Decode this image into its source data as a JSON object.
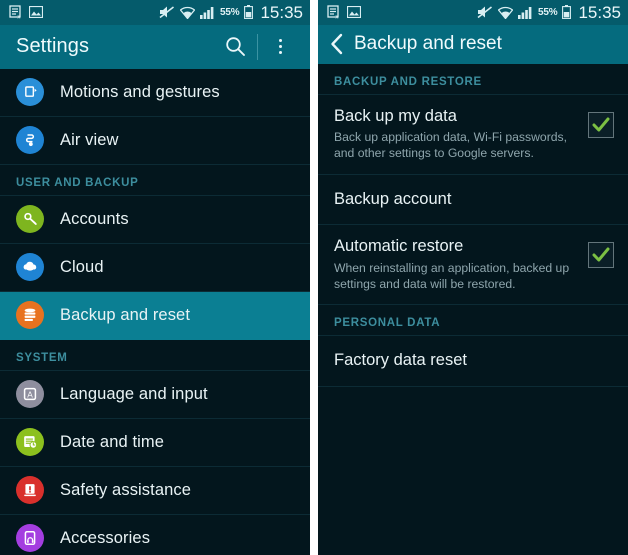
{
  "statusbar": {
    "icons_left": [
      "no-messaging-icon",
      "screenshot-image-icon"
    ],
    "icons_right": [
      "mute-icon",
      "wifi-icon",
      "signal-icon",
      "battery-icon"
    ],
    "battery_percent": "55%",
    "clock": "15:35"
  },
  "left_screen": {
    "appbar": {
      "title": "Settings",
      "search_icon": "search-icon",
      "overflow_icon": "overflow-menu-icon"
    },
    "items": [
      {
        "type": "row",
        "label": "Motions and gestures",
        "icon": "motions-icon",
        "color": "#2a8fd8",
        "selected": false
      },
      {
        "type": "row",
        "label": "Air view",
        "icon": "air-view-icon",
        "color": "#1f84d4",
        "selected": false
      },
      {
        "type": "section",
        "label": "USER AND BACKUP"
      },
      {
        "type": "row",
        "label": "Accounts",
        "icon": "key-icon",
        "color": "#7eb51f",
        "selected": false
      },
      {
        "type": "row",
        "label": "Cloud",
        "icon": "cloud-icon",
        "color": "#1f84d4",
        "selected": false
      },
      {
        "type": "row",
        "label": "Backup and reset",
        "icon": "database-icon",
        "color": "#e8721f",
        "selected": true
      },
      {
        "type": "section",
        "label": "SYSTEM"
      },
      {
        "type": "row",
        "label": "Language and input",
        "icon": "language-icon",
        "color": "#8e8e9e",
        "selected": false
      },
      {
        "type": "row",
        "label": "Date and time",
        "icon": "clock-icon",
        "color": "#8cc01e",
        "selected": false
      },
      {
        "type": "row",
        "label": "Safety assistance",
        "icon": "alert-icon",
        "color": "#d9302c",
        "selected": false
      },
      {
        "type": "row",
        "label": "Accessories",
        "icon": "headset-icon",
        "color": "#a43ee0",
        "selected": false
      }
    ]
  },
  "right_screen": {
    "appbar": {
      "title": "Backup and reset",
      "back_icon": "back-chevron-icon"
    },
    "items": [
      {
        "type": "section",
        "label": "BACKUP AND RESTORE"
      },
      {
        "type": "row",
        "title": "Back up my data",
        "subtitle": "Back up application data, Wi-Fi passwords, and other settings to Google servers.",
        "checkbox": true,
        "checked": true
      },
      {
        "type": "row",
        "title": "Backup account",
        "subtitle": "",
        "checkbox": false,
        "checked": false
      },
      {
        "type": "row",
        "title": "Automatic restore",
        "subtitle": "When reinstalling an application, backed up settings and data will be restored.",
        "checkbox": true,
        "checked": true
      },
      {
        "type": "section",
        "label": "PERSONAL DATA"
      },
      {
        "type": "row",
        "title": "Factory data reset",
        "subtitle": "",
        "checkbox": false,
        "checked": false
      }
    ]
  },
  "colors": {
    "appbar_teal": "#056b7e",
    "statusbar_teal": "#055b6b",
    "background_dark": "#03161d",
    "selected_teal": "#0b7f93",
    "section_label": "#3d8e9e",
    "checkmark_green": "#7cc043"
  }
}
